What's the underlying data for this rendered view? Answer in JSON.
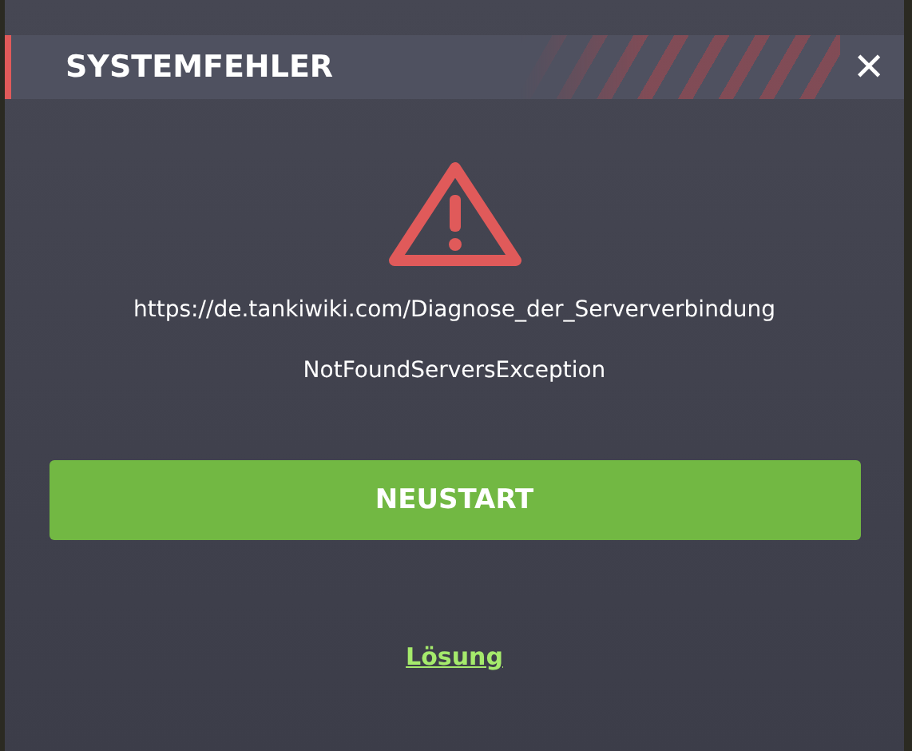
{
  "dialog": {
    "title": "SYSTEMFEHLER",
    "close_label": "✕",
    "url": "https://de.tankiwiki.com/Diagnose_der_Serververbindung",
    "error": "NotFoundServersException",
    "button": "NEUSTART",
    "link": "Lösung"
  }
}
